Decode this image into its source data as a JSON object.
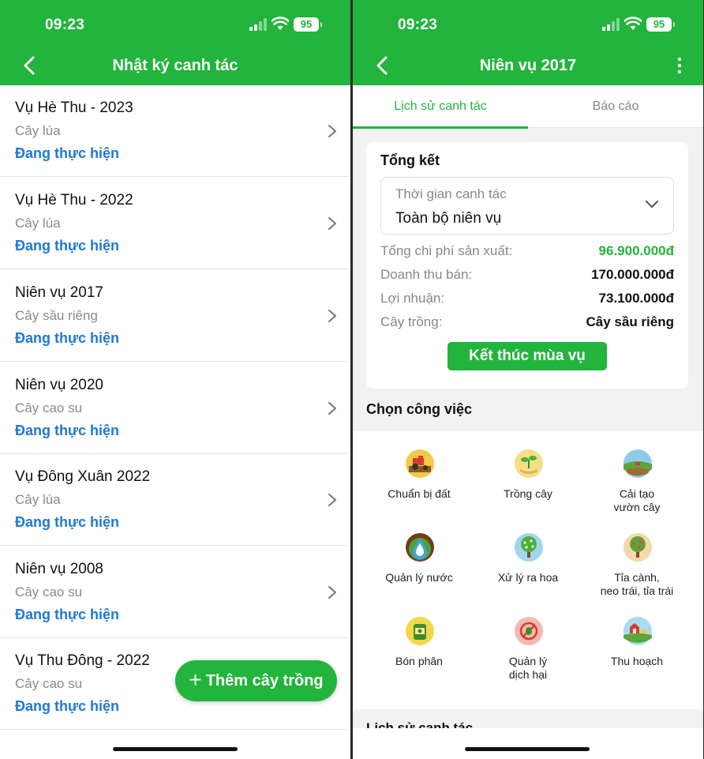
{
  "left": {
    "status": {
      "time": "09:23",
      "battery": "95"
    },
    "title": "Nhật ký canh tác",
    "items": [
      {
        "title": "Vụ Hè Thu - 2023",
        "crop": "Cây lúa",
        "status": "Đang thực hiện"
      },
      {
        "title": "Vụ Hè Thu - 2022",
        "crop": "Cây lúa",
        "status": "Đang thực hiện"
      },
      {
        "title": "Niên vụ 2017",
        "crop": "Cây sầu riêng",
        "status": "Đang thực hiện"
      },
      {
        "title": "Niên vụ 2020",
        "crop": "Cây cao su",
        "status": "Đang thực hiện"
      },
      {
        "title": "Vụ Đông Xuân 2022",
        "crop": "Cây lúa",
        "status": "Đang thực hiện"
      },
      {
        "title": "Niên vụ 2008",
        "crop": "Cây cao su",
        "status": "Đang thực hiện"
      },
      {
        "title": "Vụ Thu Đông - 2022",
        "crop": "Cây cao su",
        "status": "Đang thực hiện"
      }
    ],
    "fab_label": "Thêm cây trồng"
  },
  "right": {
    "status": {
      "time": "09:23",
      "battery": "95"
    },
    "title": "Niên vụ 2017",
    "tabs": [
      {
        "label": "Lịch sử canh tác",
        "active": true
      },
      {
        "label": "Báo cáo",
        "active": false
      }
    ],
    "summary": {
      "title": "Tổng kết",
      "period_label": "Thời gian canh tác",
      "period_value": "Toàn bộ niên vụ",
      "rows": [
        {
          "label": "Tổng chi phí sản xuất:",
          "value": "96.900.000đ"
        },
        {
          "label": "Doanh thu bán:",
          "value": "170.000.000đ"
        },
        {
          "label": "Lợi nhuận:",
          "value": "73.100.000đ"
        },
        {
          "label": "Cây trồng:",
          "value": "Cây sầu riêng"
        }
      ],
      "end_button": "Kết thúc mùa vụ"
    },
    "tasks_title": "Chọn công việc",
    "tasks": [
      {
        "label": "Chuẩn bị đất",
        "icon": "tractor-icon"
      },
      {
        "label": "Trồng cây",
        "icon": "seedling-hand-icon"
      },
      {
        "label": "Cải tạo\nvườn cây",
        "icon": "farm-field-icon"
      },
      {
        "label": "Quản lý nước",
        "icon": "water-drop-icon"
      },
      {
        "label": "Xử lý ra hoa",
        "icon": "flowering-tree-icon"
      },
      {
        "label": "Tỉa cành,\nneo trái, tỉa trái",
        "icon": "fruit-tree-icon"
      },
      {
        "label": "Bón phân",
        "icon": "fertilizer-bag-icon"
      },
      {
        "label": "Quản lý\ndịch hại",
        "icon": "pest-control-icon"
      },
      {
        "label": "Thu hoạch",
        "icon": "harvest-barn-icon"
      }
    ],
    "history_title": "Lịch sử canh tác"
  },
  "colors": {
    "brand_green": "#22b43c",
    "status_blue": "#1f78d6"
  }
}
